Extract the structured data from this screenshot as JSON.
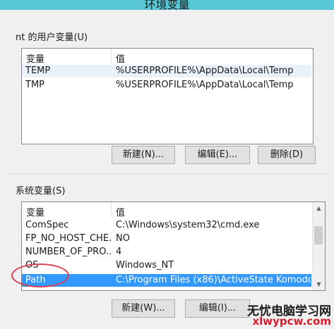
{
  "window": {
    "title": "环境变量"
  },
  "user_vars": {
    "group_label": "nt 的用户变量(U)",
    "columns": {
      "name": "变量",
      "value": "值"
    },
    "rows": [
      {
        "name": "TEMP",
        "value": "%USERPROFILE%\\AppData\\Local\\Temp"
      },
      {
        "name": "TMP",
        "value": "%USERPROFILE%\\AppData\\Local\\Temp"
      }
    ],
    "buttons": {
      "new": "新建(N)...",
      "edit": "编辑(E)...",
      "delete": "删除(D)"
    }
  },
  "system_vars": {
    "group_label": "系统变量(S)",
    "columns": {
      "name": "变量",
      "value": "值"
    },
    "rows": [
      {
        "name": "ComSpec",
        "value": "C:\\Windows\\system32\\cmd.exe"
      },
      {
        "name": "FP_NO_HOST_CHE...",
        "value": "NO"
      },
      {
        "name": "NUMBER_OF_PRO...",
        "value": "4"
      },
      {
        "name": "OS",
        "value": "Windows_NT"
      },
      {
        "name": "Path",
        "value": "C:\\Program Files (x86)\\ActiveState Komodo ..."
      }
    ],
    "selected_row": "Path",
    "buttons": {
      "new": "新建(W)...",
      "edit": "编辑(I)..."
    }
  },
  "watermark": {
    "line1": "无忧电脑学习网",
    "line2": "xlwypcw.com"
  },
  "colors": {
    "selection": "#3399ff",
    "title_bar": "#58c8d9",
    "highlight_circle": "#d84050",
    "watermark_red": "#d81e2c"
  }
}
